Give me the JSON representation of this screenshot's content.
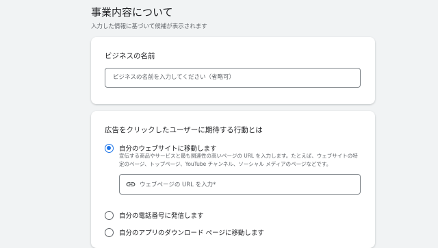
{
  "section": {
    "title": "事業内容について",
    "subtitle": "入力した情報に基づいて候補が表示されます"
  },
  "business_name": {
    "label": "ビジネスの名前",
    "placeholder": "ビジネスの名前を入力してください（省略可）"
  },
  "goal": {
    "question": "広告をクリックしたユーザーに期待する行動とは",
    "options": [
      {
        "label": "自分のウェブサイトに移動します",
        "selected": true,
        "description": "宣伝する商品やサービスと最も関連性の高いページの URL を入力します。たとえば、ウェブサイトの特定のページ、トップページ、YouTube チャンネル、ソーシャル メディアのページなどです。",
        "url_placeholder": "ウェブページの URL を入力*",
        "url_icon": "link-icon"
      },
      {
        "label": "自分の電話番号に発信します",
        "selected": false
      },
      {
        "label": "自分のアプリのダウンロード ページに移動します",
        "selected": false
      }
    ]
  },
  "colors": {
    "accent": "#1a73e8",
    "background": "#f1f3f4"
  }
}
